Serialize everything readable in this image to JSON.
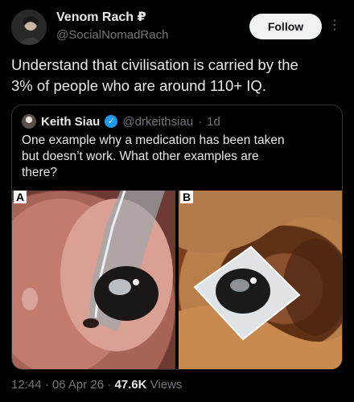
{
  "author": {
    "display_name": "Venom Rach",
    "badge_glyph": "₽",
    "handle": "@SocialNomadRach"
  },
  "follow_label": "Follow",
  "more_glyph": "⋮",
  "tweet": {
    "line1": "Understand that civilisation is carried by the",
    "line2": "3% of people who are around 110+ IQ."
  },
  "quote": {
    "name": "Keith Siau",
    "verified_glyph": "✓",
    "handle": "@drkeithsiau",
    "dot": "·",
    "time": "1d",
    "line1": "One example why a medication has been taken",
    "line2": "but doesn’t work. What other examples are",
    "line3": "there?",
    "image_a_label": "A",
    "image_b_label": "B"
  },
  "footer": {
    "time": "12:44",
    "sep1": "·",
    "date": "06 Apr 26",
    "sep2": "·",
    "views_count": "47.6K",
    "views_label": "Views"
  },
  "colors": {
    "background": "#000000",
    "text": "#e7e9ea",
    "muted": "#71767b",
    "verified": "#1d9bf0"
  }
}
